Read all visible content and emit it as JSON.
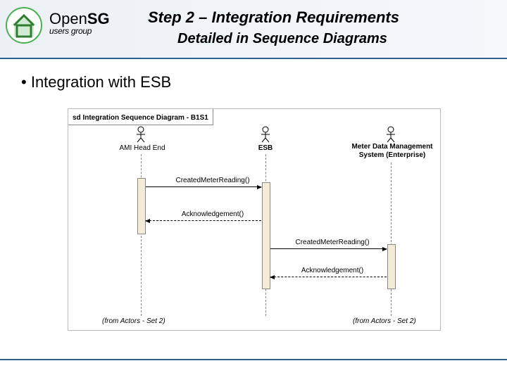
{
  "brand": {
    "open": "Open",
    "sg": "SG",
    "ug": "users group"
  },
  "title": "Step 2 – Integration Requirements",
  "subtitle": "Detailed in Sequence Diagrams",
  "bullet": "Integration with ESB",
  "diag": {
    "frame_label": "sd Integration Sequence Diagram - B1S1",
    "actors": {
      "a": "AMI Head End",
      "b": "ESB",
      "c_line1": "Meter Data Management",
      "c_line2": "System (Enterprise)"
    },
    "msgs": {
      "m1": "CreatedMeterReading()",
      "m2": "Acknowledgement()",
      "m3": "CreatedMeterReading()",
      "m4": "Acknowledgement()"
    },
    "footers": {
      "left": "(from Actors - Set 2)",
      "right": "(from Actors - Set 2)"
    }
  }
}
